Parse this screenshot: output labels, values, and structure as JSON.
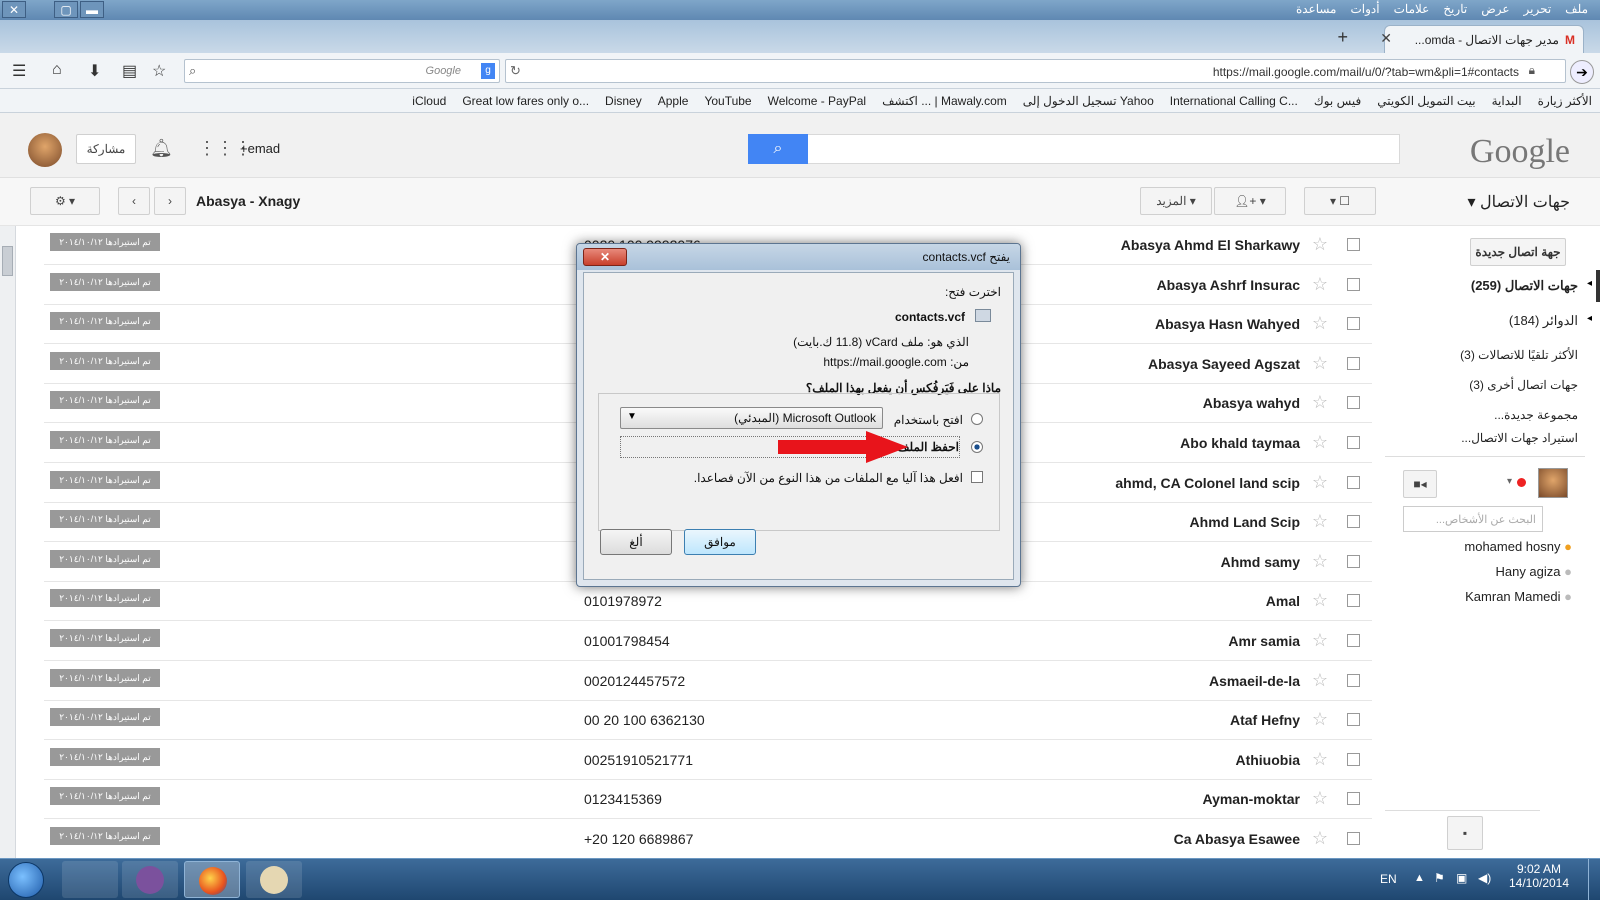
{
  "window": {
    "menus": [
      "ملف",
      "تحرير",
      "عرض",
      "تاريخ",
      "علامات",
      "أدوات",
      "مساعدة"
    ],
    "tab_title": "مدير جهات الاتصال - omda...",
    "url": "https://mail.google.com/mail/u/0/?tab=wm&pli=1#contacts",
    "search_engine": "Google"
  },
  "bookmarks": [
    "الأكثر زيارة",
    "البداية",
    "بيت التمويل الكويتي",
    "فيس بوك",
    "International Calling C...",
    "تسجيل الدخول إلى Yahoo",
    "اكتشف ... | Mawaly.com",
    "Welcome - PayPal",
    "YouTube",
    "Apple",
    "Disney",
    "Great low fares only o...",
    "iCloud"
  ],
  "google_header": {
    "logo": "Google",
    "user": "+emad",
    "share_label": "مشاركة",
    "search_placeholder": ""
  },
  "toolbar": {
    "section_title": "جهات الاتصال",
    "more_label": "المزيد",
    "group_title": "Abasya - Xnagy"
  },
  "sidebar": {
    "new_contact": "جهة اتصال جديدة",
    "items": [
      {
        "label": "جهات الاتصال (259)"
      },
      {
        "label": "الدوائر (184)"
      },
      {
        "label": "الأكثر تلقيًا للاتصالات (3)"
      },
      {
        "label": "جهات اتصال أخرى (3)"
      },
      {
        "label": "مجموعة جديدة..."
      },
      {
        "label": "استيراد جهات الاتصال..."
      }
    ],
    "people_search_placeholder": "البحث عن الأشخاص...",
    "people": [
      "mohamed hosny",
      "Hany agiza",
      "Kamran Mamedi"
    ]
  },
  "contacts": [
    {
      "name": "Abasya Ahmd El Sharkawy",
      "phone": "0020 100 9992076",
      "badge": "تم استيرادها ٢٠١٤/١٠/١٢"
    },
    {
      "name": "Abasya Ashrf Insurac",
      "phone": "",
      "badge": "تم استيرادها ٢٠١٤/١٠/١٢"
    },
    {
      "name": "Abasya Hasn Wahyed",
      "phone": "",
      "badge": "تم استيرادها ٢٠١٤/١٠/١٢"
    },
    {
      "name": "Abasya Sayeed Agszat",
      "phone": "",
      "badge": "تم استيرادها ٢٠١٤/١٠/١٢"
    },
    {
      "name": "Abasya wahyd",
      "phone": "",
      "badge": "تم استيرادها ٢٠١٤/١٠/١٢"
    },
    {
      "name": "Abo khald taymaa",
      "phone": "",
      "badge": "تم استيرادها ٢٠١٤/١٠/١٢"
    },
    {
      "name": "ahmd, CA Colonel land scip",
      "phone": "",
      "badge": "تم استيرادها ٢٠١٤/١٠/١٢"
    },
    {
      "name": "Ahmd Land Scip",
      "phone": "",
      "badge": "تم استيرادها ٢٠١٤/١٠/١٢"
    },
    {
      "name": "Ahmd samy",
      "phone": "",
      "badge": "تم استيرادها ٢٠١٤/١٠/١٢"
    },
    {
      "name": "Amal",
      "phone": "0101978972",
      "badge": "تم استيرادها ٢٠١٤/١٠/١٢"
    },
    {
      "name": "Amr samia",
      "phone": "01001798454",
      "badge": "تم استيرادها ٢٠١٤/١٠/١٢"
    },
    {
      "name": "Asmaeil-de-la",
      "phone": "0020124457572",
      "badge": "تم استيرادها ٢٠١٤/١٠/١٢"
    },
    {
      "name": "Ataf Hefny",
      "phone": "00 20 100 6362130",
      "badge": "تم استيرادها ٢٠١٤/١٠/١٢"
    },
    {
      "name": "Athiuobia",
      "phone": "00251910521771",
      "badge": "تم استيرادها ٢٠١٤/١٠/١٢"
    },
    {
      "name": "Ayman-moktar",
      "phone": "0123415369",
      "badge": "تم استيرادها ٢٠١٤/١٠/١٢"
    },
    {
      "name": "Ca Abasya Esawee",
      "phone": "+20 120 6689867",
      "badge": "تم استيرادها ٢٠١٤/١٠/١٢"
    }
  ],
  "dialog": {
    "title": "يفتح contacts.vcf",
    "chose_open": "اخترت فتح:",
    "filename": "contacts.vcf",
    "file_type": "الذي هو: ملف vCard (11.8 ك.بايت)",
    "from": "من: https://mail.google.com",
    "question": "ماذا على فَيَرفُكس أن يفعل بهذا الملف؟",
    "open_with_label": "افتح باستخدام",
    "open_with_app": "Microsoft Outlook (المبدئي)",
    "save_label": "احفظ الملف",
    "remember_label": "افعل هذا آليا مع الملفات من هذا النوع من الآن فصاعدا.",
    "ok": "موافق",
    "cancel": "ألغ"
  },
  "taskbar": {
    "lang": "EN",
    "time": "9:02 AM",
    "date": "14/10/2014"
  },
  "colors": {
    "accent": "#4285f4",
    "arrow": "#e8141b",
    "taskbar": "#1f4770"
  }
}
